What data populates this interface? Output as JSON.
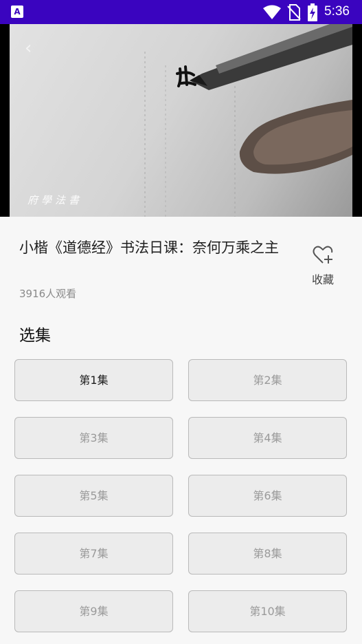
{
  "status_bar": {
    "app_badge": "A",
    "time": "5:36",
    "colors": {
      "background": "#3a04bf",
      "foreground": "#ffffff"
    },
    "icons": [
      "wifi-icon",
      "sim-off-icon",
      "battery-charging-icon"
    ]
  },
  "video": {
    "watermark": "府學法書",
    "back_icon": "chevron-left-icon"
  },
  "detail": {
    "title": "小楷《道德经》书法日课：奈何万乘之主",
    "views": "3916人观看",
    "favorite_label": "收藏",
    "favorite_icon": "heart-plus-icon"
  },
  "episodes": {
    "heading": "选集",
    "selected_index": 0,
    "items": [
      "第1集",
      "第2集",
      "第3集",
      "第4集",
      "第5集",
      "第6集",
      "第7集",
      "第8集",
      "第9集",
      "第10集"
    ]
  }
}
